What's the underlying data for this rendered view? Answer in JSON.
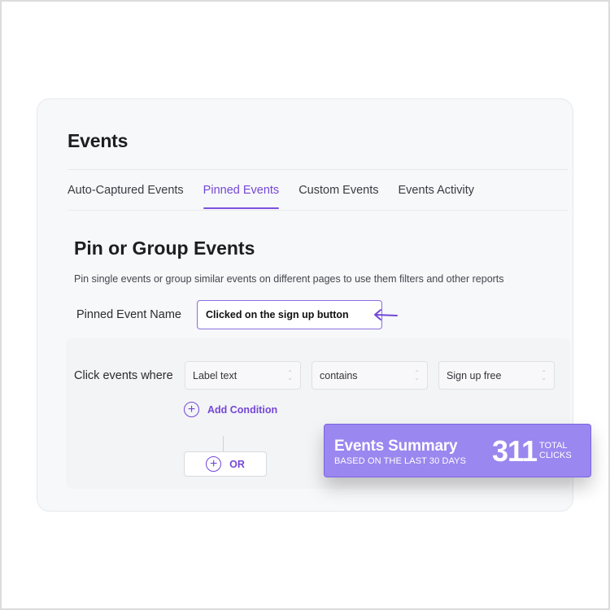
{
  "page": {
    "title": "Events"
  },
  "tabs": [
    {
      "label": "Auto-Captured Events",
      "active": false
    },
    {
      "label": "Pinned Events",
      "active": true
    },
    {
      "label": "Custom Events",
      "active": false
    },
    {
      "label": "Events Activity",
      "active": false
    }
  ],
  "section": {
    "title": "Pin or Group Events",
    "description": "Pin single events or group similar events on different pages to use them filters and other reports"
  },
  "pinned_event": {
    "label": "Pinned Event Name",
    "value": "Clicked on the sign up button"
  },
  "conditions": {
    "label": "Click events where",
    "field": "Label text",
    "operator": "contains",
    "value": "Sign up free",
    "add_condition_label": "Add Condition",
    "or_label": "OR"
  },
  "summary": {
    "title": "Events Summary",
    "subtitle": "BASED ON THE LAST 30 DAYS",
    "count": "311",
    "unit_line1": "TOTAL",
    "unit_line2": "CLICKS"
  },
  "colors": {
    "accent": "#7447d6",
    "summary_bg": "#9a87ef",
    "card_bg": "#f7f8fa"
  },
  "icons": {
    "add": "plus-circle-icon",
    "select": "chevron-up-down-icon",
    "pointer": "arrow-left-icon"
  }
}
